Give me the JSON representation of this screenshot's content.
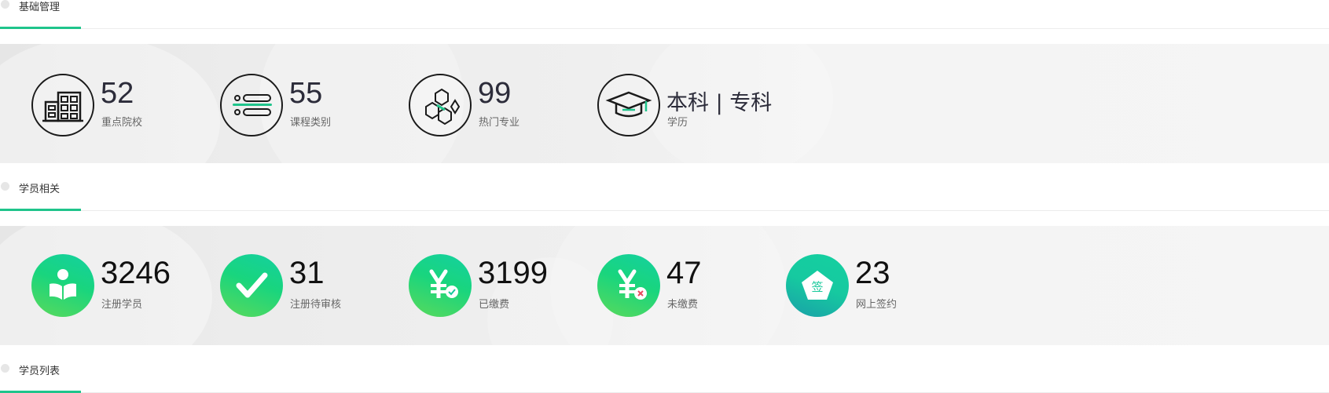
{
  "sections": {
    "basic": {
      "title": "基础管理"
    },
    "students": {
      "title": "学员相关"
    },
    "list": {
      "title": "学员列表"
    }
  },
  "basic_stats": [
    {
      "value": "52",
      "label": "重点院校",
      "icon": "building-icon"
    },
    {
      "value": "55",
      "label": "课程类别",
      "icon": "list-icon"
    },
    {
      "value": "99",
      "label": "热门专业",
      "icon": "hexagons-icon"
    },
    {
      "value": "本科 | 专科",
      "label": "学历",
      "icon": "graduation-cap-icon"
    }
  ],
  "student_stats": [
    {
      "value": "3246",
      "label": "注册学员",
      "icon": "book-reader-icon"
    },
    {
      "value": "31",
      "label": "注册待审核",
      "icon": "checkmark-icon"
    },
    {
      "value": "3199",
      "label": "已缴费",
      "icon": "yuan-paid-icon"
    },
    {
      "value": "47",
      "label": "未缴费",
      "icon": "yuan-unpaid-icon"
    },
    {
      "value": "23",
      "label": "网上签约",
      "icon": "sign-pentagon-icon",
      "icon_text": "签"
    }
  ],
  "colors": {
    "accent": "#1fc48b",
    "icon_gradient_start": "#14d0a0",
    "icon_gradient_end": "#5ad95b"
  }
}
